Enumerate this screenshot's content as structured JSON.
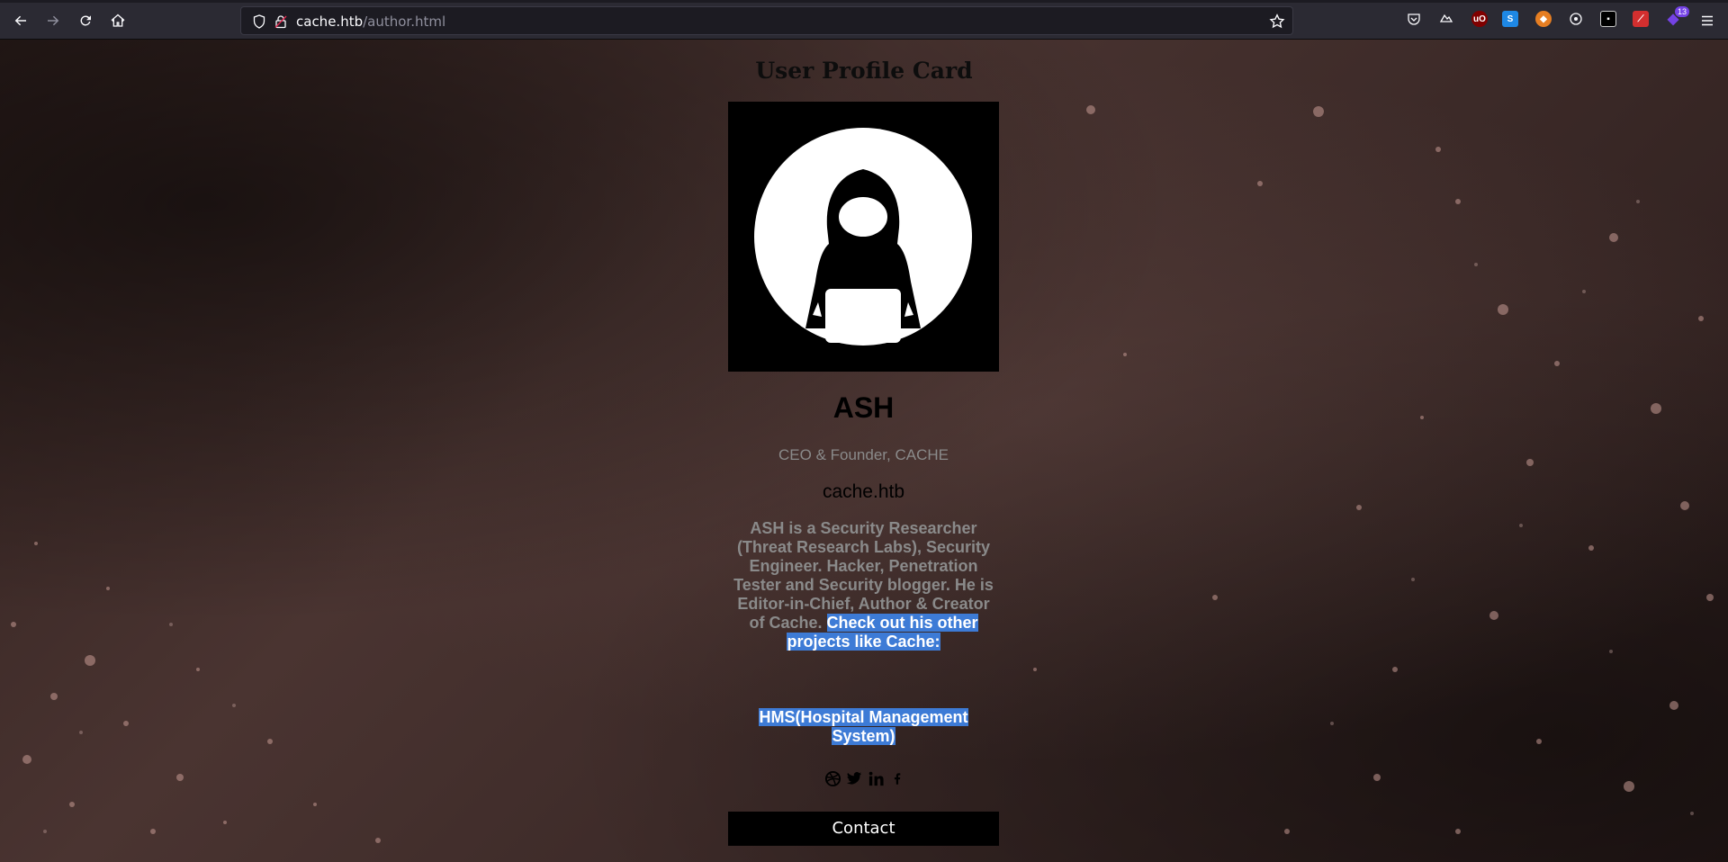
{
  "browser": {
    "url_host": "cache.htb",
    "url_path": "/author.html",
    "extension_badge": "13"
  },
  "page": {
    "heading": "User Profile Card",
    "profile": {
      "name": "ASH",
      "role": "CEO & Founder, CACHE",
      "website": "cache.htb",
      "bio_plain": "ASH is a Security Researcher (Threat Research Labs), Security Engineer. Hacker, Penetration Tester and Security blogger. He is Editor-in-Chief, Author & Creator of Cache. ",
      "bio_selected": "Check out his other projects like Cache:",
      "project": "HMS(Hospital Management System)",
      "social_icons": [
        "dribbble-icon",
        "twitter-icon",
        "linkedin-icon",
        "facebook-icon"
      ]
    },
    "contact_label": "Contact"
  },
  "colors": {
    "selection": "#3d7bd6",
    "card_black": "#000000",
    "muted_text": "#8a8a8a"
  }
}
